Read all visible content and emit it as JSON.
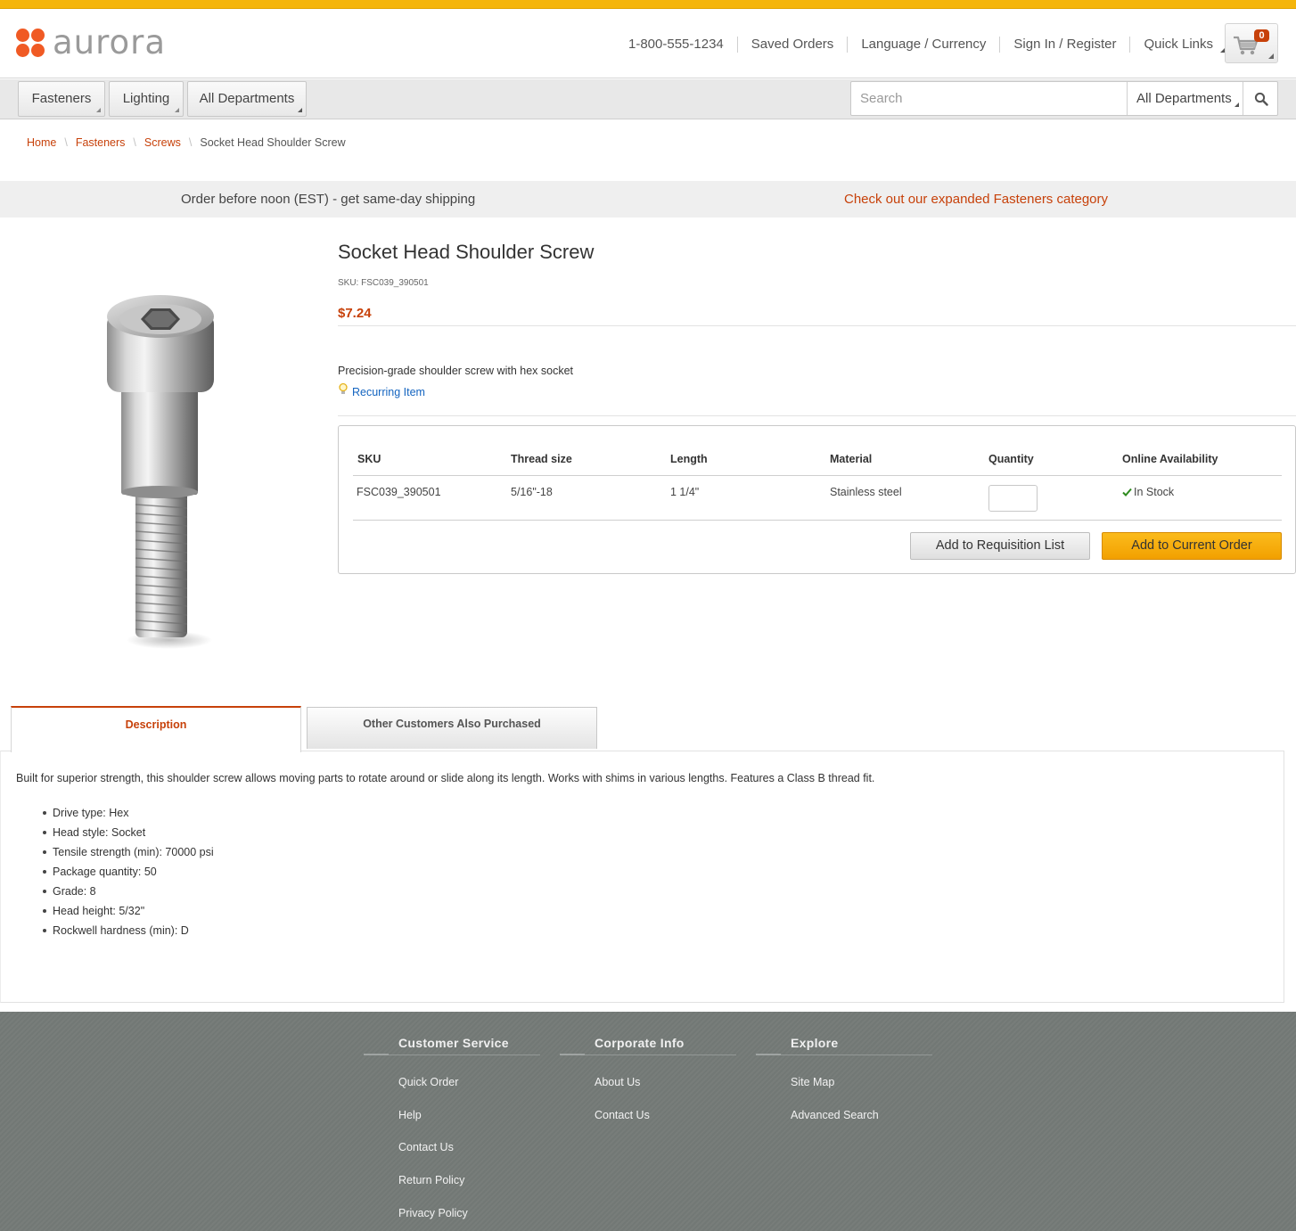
{
  "brand": {
    "name": "aurora",
    "logo_color": "#f05a24",
    "accent_color": "#c7410a",
    "topbar_color": "#f5b50b"
  },
  "header": {
    "phone": "1-800-555-1234",
    "saved_orders": "Saved Orders",
    "language_currency": "Language / Currency",
    "sign_in": "Sign In / Register",
    "quick_links": "Quick Links",
    "cart_count": "0",
    "cart_icon": "shopping-cart-icon"
  },
  "nav": {
    "departments": [
      "Fasteners",
      "Lighting",
      "All Departments"
    ],
    "search_placeholder": "Search",
    "search_scope": "All Departments",
    "search_icon": "magnifier-icon"
  },
  "breadcrumb": {
    "home": "Home",
    "level1": "Fasteners",
    "level2": "Screws",
    "current": "Socket Head Shoulder Screw"
  },
  "promo": {
    "left": "Order before noon (EST) - get same-day shipping",
    "right": "Check out our expanded Fasteners category"
  },
  "product": {
    "title": "Socket Head Shoulder Screw",
    "sku_line": "SKU: FSC039_390501",
    "price": "$7.24",
    "short_description": "Precision-grade shoulder screw with hex socket",
    "recurring_label": "Recurring Item",
    "recurring_icon": "lightbulb-icon",
    "image_icon": "socket-head-shoulder-screw-image"
  },
  "sku_table": {
    "headers": [
      "SKU",
      "Thread size",
      "Length",
      "Material",
      "Quantity",
      "Online Availability"
    ],
    "row": {
      "sku": "FSC039_390501",
      "thread": "5/16\"-18",
      "length": "1 1/4\"",
      "material": "Stainless steel",
      "quantity": "",
      "availability": "In Stock"
    },
    "availability_icon": "checkmark-icon",
    "availability_color": "#2e8b1e",
    "add_requisition": "Add to Requisition List",
    "add_order": "Add to Current Order"
  },
  "tabs": {
    "description": "Description",
    "also_purchased": "Other Customers Also Purchased",
    "active": "Description"
  },
  "description": {
    "text": "Built for superior strength, this shoulder screw allows moving parts to rotate around or slide along its length. Works with shims in various lengths. Features a Class B thread fit.",
    "attributes": [
      "Drive type: Hex",
      "Head style: Socket",
      "Tensile strength (min): 70000 psi",
      "Package quantity: 50",
      "Grade: 8",
      "Head height: 5/32\"",
      "Rockwell hardness (min): D"
    ]
  },
  "footer": {
    "columns": [
      {
        "title": "Customer Service",
        "links": [
          "Quick Order",
          "Help",
          "Contact Us",
          "Return Policy",
          "Privacy Policy"
        ]
      },
      {
        "title": "Corporate Info",
        "links": [
          "About Us",
          "Contact Us"
        ]
      },
      {
        "title": "Explore",
        "links": [
          "Site Map",
          "Advanced Search"
        ]
      }
    ]
  }
}
